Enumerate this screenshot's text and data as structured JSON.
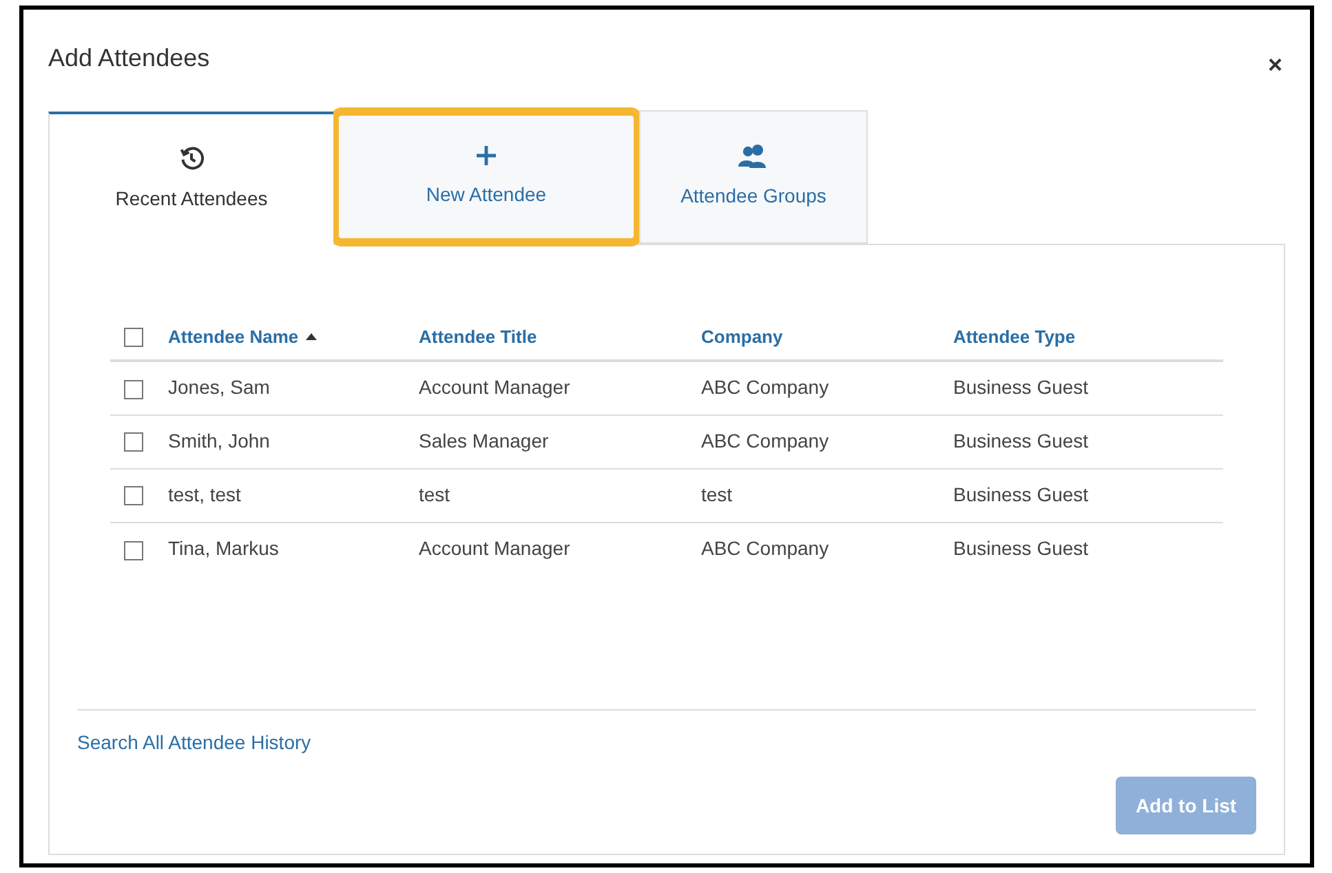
{
  "dialog": {
    "title": "Add Attendees",
    "close": "×"
  },
  "tabs": [
    {
      "label": "Recent Attendees",
      "kind": "history",
      "selected": true,
      "highlighted": false
    },
    {
      "label": "New Attendee",
      "kind": "plus",
      "selected": false,
      "highlighted": true
    },
    {
      "label": "Attendee Groups",
      "kind": "users",
      "selected": false,
      "highlighted": false
    }
  ],
  "table": {
    "select_all": {
      "checked": false
    },
    "columns": [
      {
        "label": "Attendee Name",
        "sorted_ascending": true
      },
      {
        "label": "Attendee Title"
      },
      {
        "label": "Company"
      },
      {
        "label": "Attendee Type"
      }
    ],
    "rows": [
      {
        "checked": false,
        "cells": [
          "Jones, Sam",
          "Account Manager",
          "ABC Company",
          "Business Guest"
        ]
      },
      {
        "checked": false,
        "cells": [
          "Smith, John",
          "Sales Manager",
          "ABC Company",
          "Business Guest"
        ]
      },
      {
        "checked": false,
        "cells": [
          "test, test",
          "test",
          "test",
          "Business Guest"
        ]
      },
      {
        "checked": false,
        "cells": [
          "Tina, Markus",
          "Account Manager",
          "ABC Company",
          "Business Guest"
        ]
      }
    ]
  },
  "link": "Search All Attendee History",
  "button": {
    "label": "Add to List",
    "disabled": true
  }
}
